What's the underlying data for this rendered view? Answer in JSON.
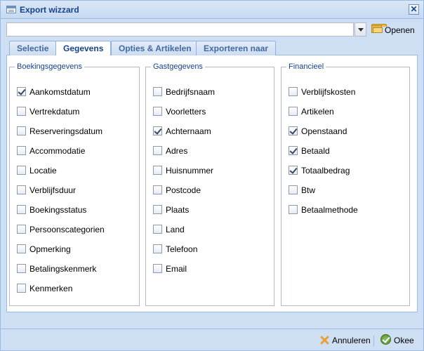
{
  "window": {
    "title": "Export wizzard"
  },
  "toolbar": {
    "combo_value": "",
    "open_label": "Openen"
  },
  "tabs": [
    {
      "label": "Selectie",
      "active": false
    },
    {
      "label": "Gegevens",
      "active": true
    },
    {
      "label": "Opties & Artikelen",
      "active": false
    },
    {
      "label": "Exporteren naar",
      "active": false
    }
  ],
  "groups": [
    {
      "legend": "Boekingsgegevens",
      "items": [
        {
          "label": "Aankomstdatum",
          "checked": true
        },
        {
          "label": "Vertrekdatum",
          "checked": false
        },
        {
          "label": "Reserveringsdatum",
          "checked": false
        },
        {
          "label": "Accommodatie",
          "checked": false
        },
        {
          "label": "Locatie",
          "checked": false
        },
        {
          "label": "Verblijfsduur",
          "checked": false
        },
        {
          "label": "Boekingsstatus",
          "checked": false
        },
        {
          "label": "Persoonscategorien",
          "checked": false
        },
        {
          "label": "Opmerking",
          "checked": false
        },
        {
          "label": "Betalingskenmerk",
          "checked": false
        },
        {
          "label": "Kenmerken",
          "checked": false
        }
      ]
    },
    {
      "legend": "Gastgegevens",
      "items": [
        {
          "label": "Bedrijfsnaam",
          "checked": false
        },
        {
          "label": "Voorletters",
          "checked": false
        },
        {
          "label": "Achternaam",
          "checked": true
        },
        {
          "label": "Adres",
          "checked": false
        },
        {
          "label": "Huisnummer",
          "checked": false
        },
        {
          "label": "Postcode",
          "checked": false
        },
        {
          "label": "Plaats",
          "checked": false
        },
        {
          "label": "Land",
          "checked": false
        },
        {
          "label": "Telefoon",
          "checked": false
        },
        {
          "label": "Email",
          "checked": false
        }
      ]
    },
    {
      "legend": "Financieel",
      "items": [
        {
          "label": "Verblijfskosten",
          "checked": false
        },
        {
          "label": "Artikelen",
          "checked": false
        },
        {
          "label": "Openstaand",
          "checked": true
        },
        {
          "label": "Betaald",
          "checked": true
        },
        {
          "label": "Totaalbedrag",
          "checked": true
        },
        {
          "label": "Btw",
          "checked": false
        },
        {
          "label": "Betaalmethode",
          "checked": false
        }
      ]
    }
  ],
  "footer": {
    "cancel_label": "Annuleren",
    "ok_label": "Okee"
  }
}
